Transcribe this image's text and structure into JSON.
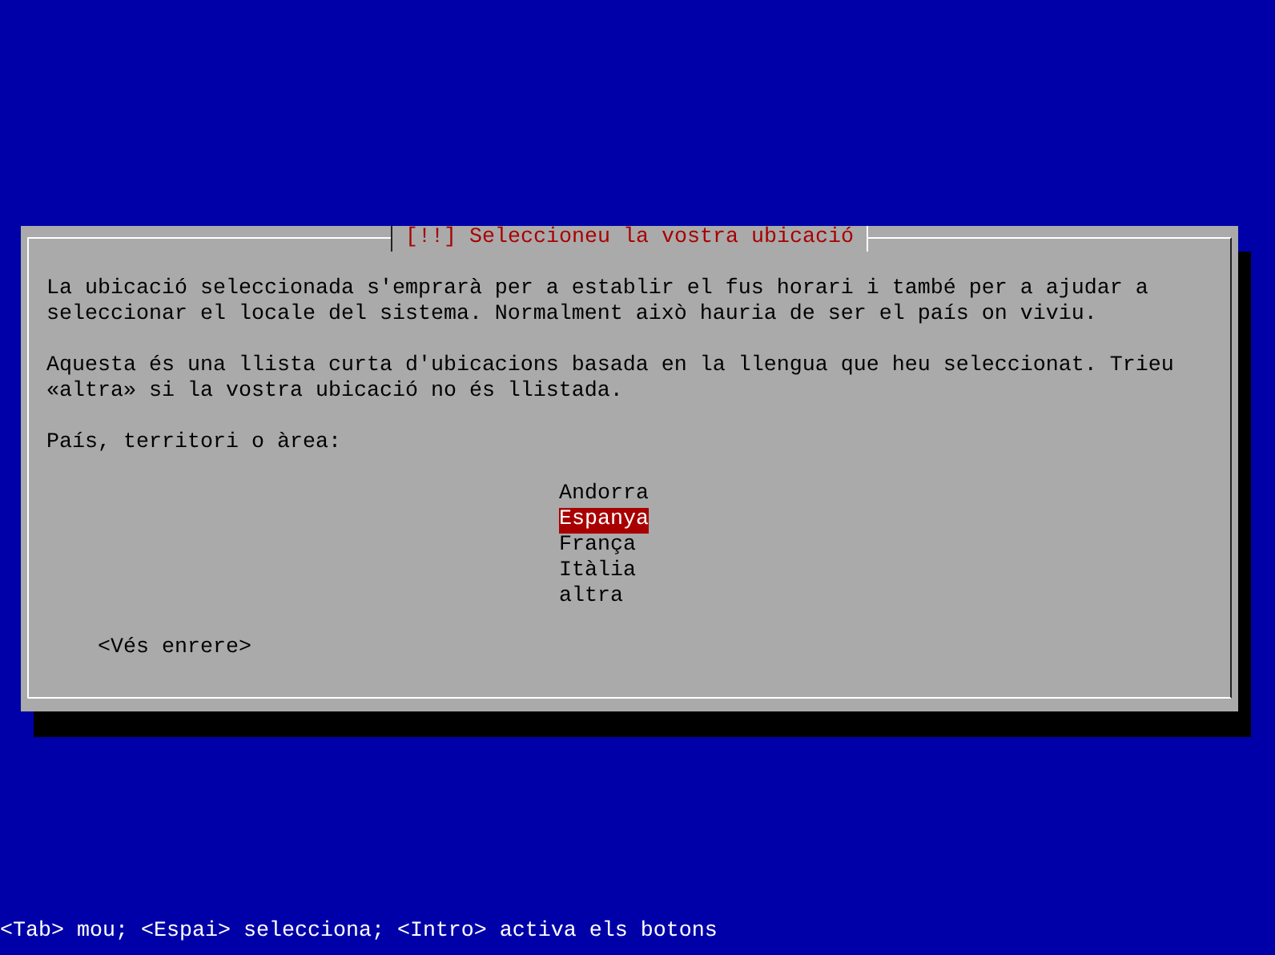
{
  "dialog": {
    "title": "[!!] Seleccioneu la vostra ubicació",
    "paragraphs": [
      "La ubicació seleccionada s'emprarà per a establir el fus horari i també per a ajudar a seleccionar el locale del sistema. Normalment això hauria de ser el país on viviu.",
      "Aquesta és una llista curta d'ubicacions basada en la llengua que heu seleccionat. Trieu «altra» si la vostra ubicació no és llistada."
    ],
    "prompt": "País, territori o àrea:",
    "options": [
      {
        "label": "Andorra",
        "selected": false
      },
      {
        "label": "Espanya",
        "selected": true
      },
      {
        "label": "França",
        "selected": false
      },
      {
        "label": "Itàlia",
        "selected": false
      },
      {
        "label": "altra",
        "selected": false
      }
    ],
    "back_button": "<Vés enrere>"
  },
  "status_bar": "<Tab> mou; <Espai> selecciona; <Intro> activa els botons"
}
